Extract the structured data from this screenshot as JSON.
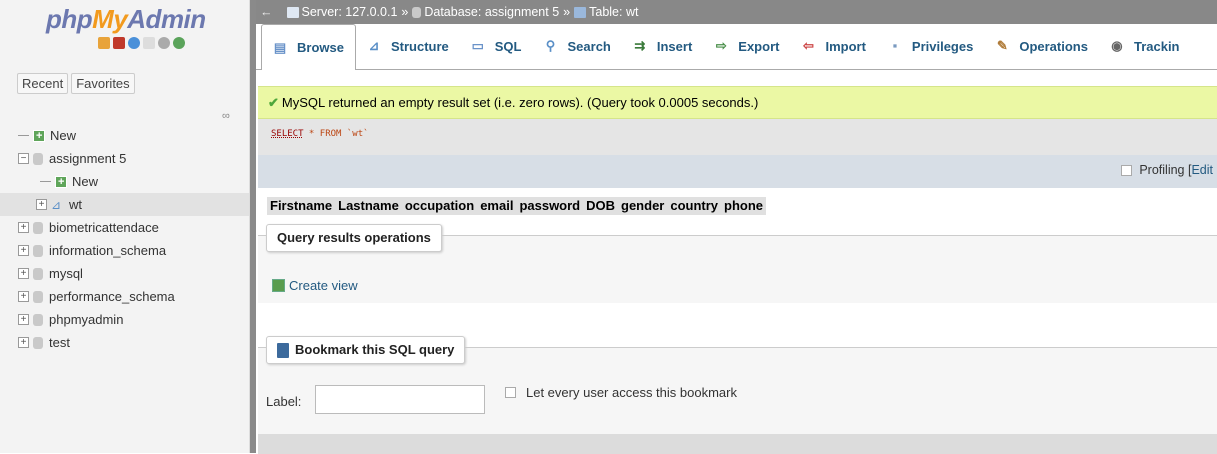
{
  "nav": {
    "logo_php": "php",
    "logo_my": "My",
    "logo_admin": "Admin",
    "tabs": [
      "Recent",
      "Favorites"
    ],
    "tree": [
      {
        "label": "New",
        "type": "new",
        "level": 0
      },
      {
        "label": "assignment 5",
        "type": "db",
        "level": 0,
        "expanded": true
      },
      {
        "label": "New",
        "type": "new",
        "level": 1
      },
      {
        "label": "wt",
        "type": "table",
        "level": 1,
        "selected": true
      },
      {
        "label": "biometricattendace",
        "type": "db",
        "level": 0
      },
      {
        "label": "information_schema",
        "type": "db",
        "level": 0
      },
      {
        "label": "mysql",
        "type": "db",
        "level": 0
      },
      {
        "label": "performance_schema",
        "type": "db",
        "level": 0
      },
      {
        "label": "phpmyadmin",
        "type": "db",
        "level": 0
      },
      {
        "label": "test",
        "type": "db",
        "level": 0
      }
    ]
  },
  "breadcrumb": {
    "server": "Server: 127.0.0.1",
    "database": "Database: assignment 5",
    "table": "Table: wt",
    "sep": "»"
  },
  "tabs": [
    {
      "label": "Browse",
      "icon": "browse-icon",
      "active": true
    },
    {
      "label": "Structure",
      "icon": "structure-icon"
    },
    {
      "label": "SQL",
      "icon": "sql-icon"
    },
    {
      "label": "Search",
      "icon": "search-icon"
    },
    {
      "label": "Insert",
      "icon": "insert-icon"
    },
    {
      "label": "Export",
      "icon": "export-icon"
    },
    {
      "label": "Import",
      "icon": "import-icon"
    },
    {
      "label": "Privileges",
      "icon": "privileges-icon"
    },
    {
      "label": "Operations",
      "icon": "operations-icon"
    },
    {
      "label": "Trackin",
      "icon": "tracking-icon"
    }
  ],
  "message": "MySQL returned an empty result set (i.e. zero rows). (Query took 0.0005 seconds.)",
  "sql": {
    "kw1": "SELECT",
    "rest": " * FROM `wt`"
  },
  "profiling": {
    "label": "Profiling [",
    "edit": "Edit"
  },
  "columns": [
    "Firstname",
    "Lastname",
    "occupation",
    "email",
    "password",
    "DOB",
    "gender",
    "country",
    "phone"
  ],
  "query_ops": {
    "legend": "Query results operations",
    "create_view": "Create view"
  },
  "bookmark": {
    "legend": "Bookmark this SQL query",
    "label": "Label:",
    "input_value": "",
    "checkbox_label": "Let every user access this bookmark"
  },
  "colors": {
    "accent": "#235a81",
    "success_bg": "#ebf8a4",
    "topbar": "#888888"
  }
}
